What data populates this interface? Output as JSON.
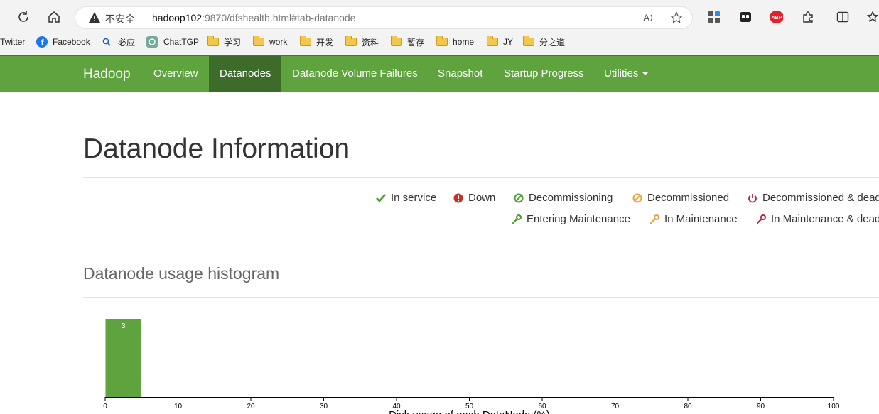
{
  "browser": {
    "insecure_label": "不安全",
    "url_host": "hadoop102",
    "url_rest": ":9870/dfshealth.html#tab-datanode",
    "extensions": [
      "read-aloud-icon",
      "favorite-star-icon",
      "apps-icon",
      "ext-dark-icon",
      "adblock-plus-icon",
      "extensions-puzzle-icon",
      "split-screen-icon",
      "favorites-icon"
    ],
    "adblock_label": "ABP"
  },
  "bookmarks": [
    {
      "label": "Twitter"
    },
    {
      "label": "Facebook"
    },
    {
      "label": "必应"
    },
    {
      "label": "ChatTGP"
    },
    {
      "label": "学习"
    },
    {
      "label": "work"
    },
    {
      "label": "开发"
    },
    {
      "label": "资料"
    },
    {
      "label": "暂存"
    },
    {
      "label": "home"
    },
    {
      "label": "JY"
    },
    {
      "label": "分之道"
    }
  ],
  "navbar": {
    "brand": "Hadoop",
    "items": [
      {
        "label": "Overview"
      },
      {
        "label": "Datanodes"
      },
      {
        "label": "Datanode Volume Failures"
      },
      {
        "label": "Snapshot"
      },
      {
        "label": "Startup Progress"
      },
      {
        "label": "Utilities"
      }
    ]
  },
  "page": {
    "title": "Datanode Information",
    "legend": [
      {
        "label": "In service",
        "icon": "check-icon",
        "color": "#4a9a2f"
      },
      {
        "label": "Down",
        "icon": "exclamation-circle-icon",
        "color": "#c9302c"
      },
      {
        "label": "Decommissioning",
        "icon": "ban-icon",
        "color": "#4a9a2f"
      },
      {
        "label": "Decommissioned",
        "icon": "ban-icon",
        "color": "#e8a33d"
      },
      {
        "label": "Decommissioned & dead",
        "icon": "power-icon",
        "color": "#b5263f"
      },
      {
        "label": "Entering Maintenance",
        "icon": "wrench-icon",
        "color": "#4a9a2f"
      },
      {
        "label": "In Maintenance",
        "icon": "wrench-icon",
        "color": "#e8a33d"
      },
      {
        "label": "In Maintenance & dead",
        "icon": "wrench-icon",
        "color": "#b5263f"
      }
    ],
    "histogram_title": "Datanode usage histogram"
  },
  "chart_data": {
    "type": "bar",
    "bins": [
      [
        0,
        5
      ]
    ],
    "values": [
      3
    ],
    "xlim": [
      0,
      100
    ],
    "xticks": [
      0,
      10,
      20,
      30,
      40,
      50,
      60,
      70,
      80,
      90,
      100
    ],
    "xlabel": "Disk usage of each DataNode (%)",
    "ymax": 3,
    "bar_color": "#5fa33e"
  }
}
